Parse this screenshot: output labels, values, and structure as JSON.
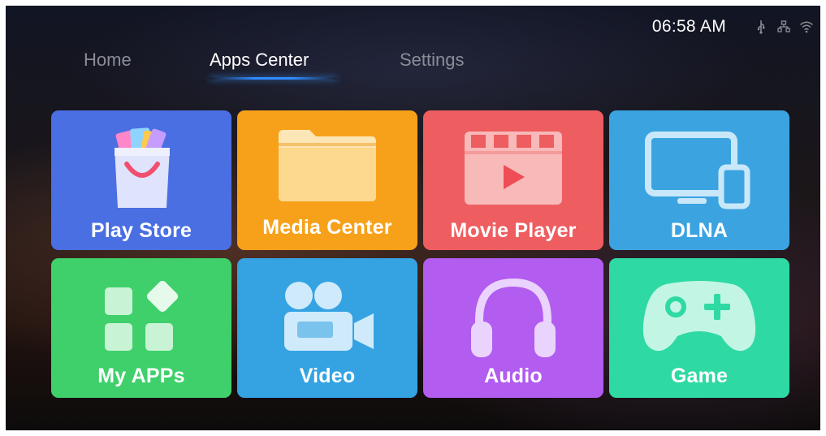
{
  "status": {
    "time": "06:58 AM",
    "icons": [
      "usb-icon",
      "ethernet-icon",
      "wifi-icon"
    ]
  },
  "nav": {
    "tabs": [
      {
        "label": "Home",
        "active": false
      },
      {
        "label": "Apps Center",
        "active": true
      },
      {
        "label": "Settings",
        "active": false
      }
    ]
  },
  "tiles": [
    {
      "label": "Play Store",
      "color": "#4a6fe3",
      "icon": "shopping-bag-icon"
    },
    {
      "label": "Media Center",
      "color": "#f7a11a",
      "icon": "folder-icon"
    },
    {
      "label": "Movie Player",
      "color": "#ee5d60",
      "icon": "film-player-icon"
    },
    {
      "label": "DLNA",
      "color": "#3ba3e0",
      "icon": "monitor-phone-icon"
    },
    {
      "label": "My APPs",
      "color": "#3fd06b",
      "icon": "apps-grid-icon"
    },
    {
      "label": "Video",
      "color": "#35a3e2",
      "icon": "video-camera-icon"
    },
    {
      "label": "Audio",
      "color": "#b25cf0",
      "icon": "headphones-icon"
    },
    {
      "label": "Game",
      "color": "#2fd9a4",
      "icon": "gamepad-icon"
    }
  ]
}
